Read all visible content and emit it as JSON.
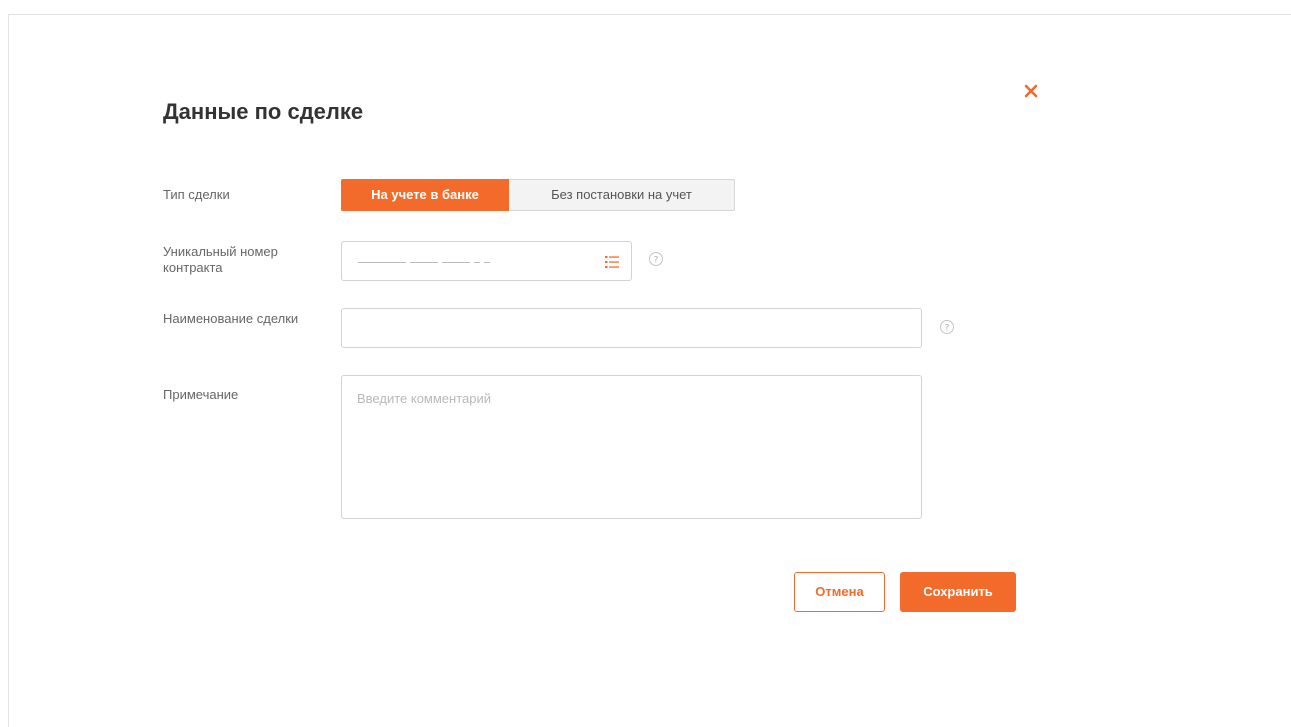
{
  "dialog": {
    "title": "Данные по сделке",
    "close_icon": "close-icon"
  },
  "deal_type": {
    "label": "Тип сделки",
    "options": [
      "На учете в банке",
      "Без постановки на учет"
    ],
    "selected": "На учете в банке"
  },
  "contract_number": {
    "label": "Уникальный номер контракта",
    "value": "",
    "mask_icon": "list-icon",
    "help_icon": "question-circle-icon"
  },
  "deal_name": {
    "label": "Наименование сделки",
    "value": "",
    "help_icon": "question-circle-icon"
  },
  "note": {
    "label": "Примечание",
    "placeholder": "Введите комментарий",
    "value": ""
  },
  "actions": {
    "cancel_label": "Отмена",
    "save_label": "Сохранить"
  },
  "colors": {
    "accent": "#f26b2a",
    "border": "#d3d3d3",
    "label": "#666666",
    "placeholder": "#b9b9b9"
  }
}
